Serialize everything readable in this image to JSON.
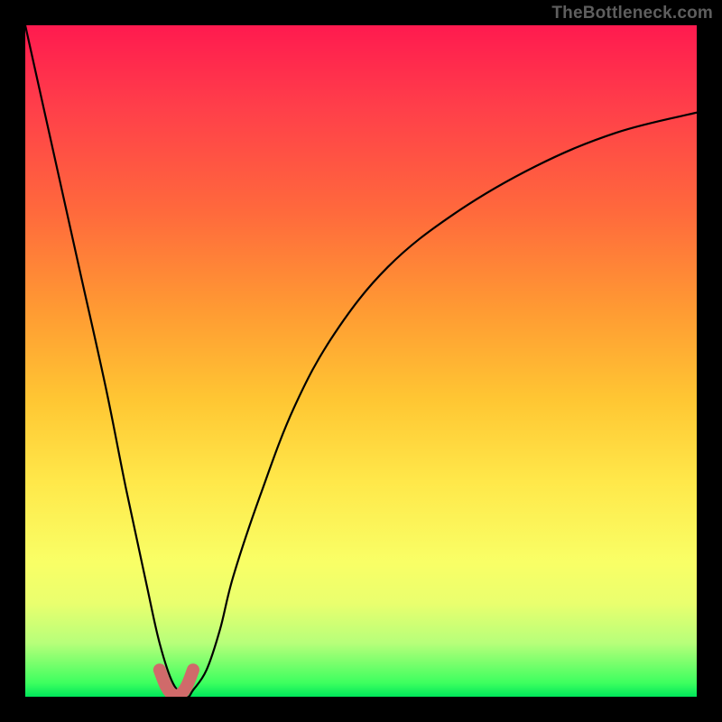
{
  "watermark": "TheBottleneck.com",
  "chart_data": {
    "type": "line",
    "title": "",
    "xlabel": "",
    "ylabel": "",
    "xlim": [
      0,
      100
    ],
    "ylim": [
      0,
      100
    ],
    "grid": false,
    "legend": false,
    "series": [
      {
        "name": "bottleneck-curve",
        "x": [
          0,
          4,
          8,
          12,
          15,
          18,
          20,
          22,
          24,
          25,
          27,
          29,
          31,
          35,
          40,
          46,
          54,
          64,
          76,
          88,
          100
        ],
        "y": [
          100,
          82,
          64,
          46,
          31,
          17,
          8,
          2,
          0,
          1,
          4,
          10,
          18,
          30,
          43,
          54,
          64,
          72,
          79,
          84,
          87
        ]
      },
      {
        "name": "trough-highlight",
        "x": [
          20,
          21,
          22,
          23,
          24,
          25
        ],
        "y": [
          4.0,
          1.5,
          0.3,
          0.3,
          1.5,
          4.0
        ]
      }
    ],
    "notes": "Axes are unlabeled; values on 0-100 normalized scale. Minimum near x≈22-23 at y≈0. Right branch asymptotes toward ~87 at x=100. Gradient background encodes y value (green=low, red=high)."
  }
}
